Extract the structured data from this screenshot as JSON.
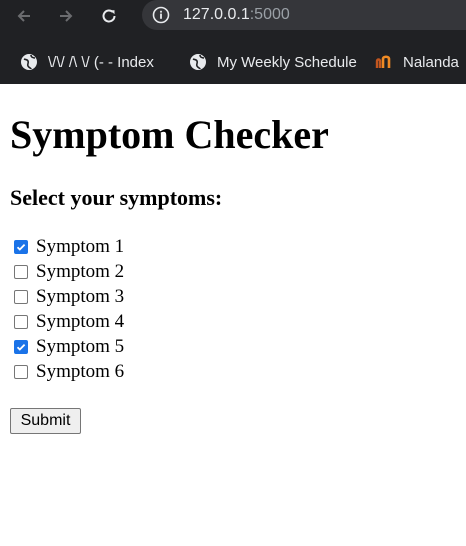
{
  "browser": {
    "url_host": "127.0.0.1",
    "url_port": ":5000",
    "bookmarks": [
      {
        "label": "\\/\\/ /\\ \\/ (- - Index",
        "icon": "globe-icon"
      },
      {
        "label": "My Weekly Schedule",
        "icon": "globe-icon"
      },
      {
        "label": "Nalanda",
        "icon": "nalanda-logo-icon"
      }
    ]
  },
  "page": {
    "title": "Symptom Checker",
    "subtitle": "Select your symptoms:",
    "symptoms": [
      {
        "label": "Symptom 1",
        "checked": true
      },
      {
        "label": "Symptom 2",
        "checked": false
      },
      {
        "label": "Symptom 3",
        "checked": false
      },
      {
        "label": "Symptom 4",
        "checked": false
      },
      {
        "label": "Symptom 5",
        "checked": true
      },
      {
        "label": "Symptom 6",
        "checked": false
      }
    ],
    "submit_label": "Submit"
  },
  "colors": {
    "chrome_bg": "#202124",
    "checkbox_checked": "#1a73e8"
  }
}
